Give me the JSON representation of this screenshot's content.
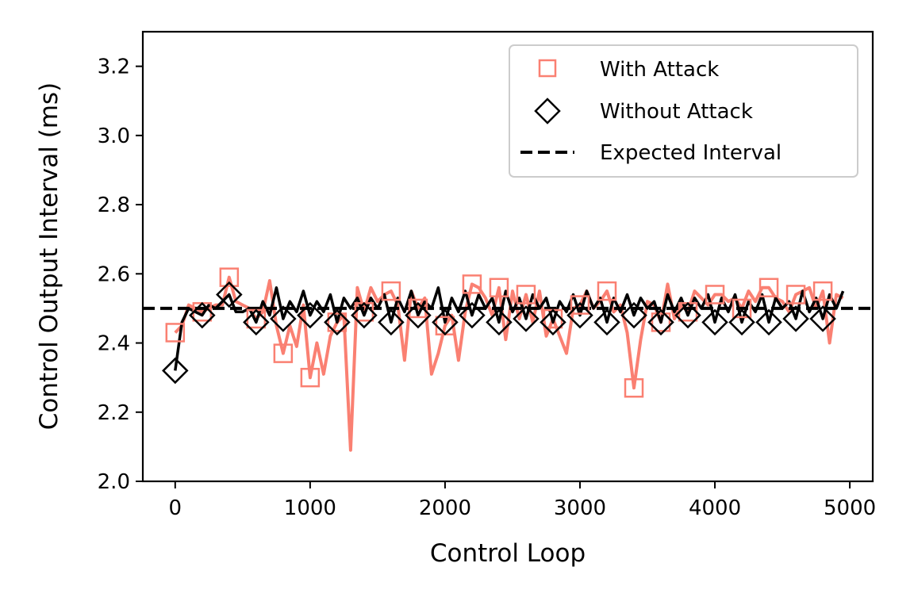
{
  "chart_data": {
    "type": "line",
    "title": "",
    "xlabel": "Control Loop",
    "ylabel": "Control Output Interval (ms)",
    "xlim": [
      -240,
      5170
    ],
    "ylim": [
      2.0,
      3.3
    ],
    "xticks": [
      0,
      1000,
      2000,
      3000,
      4000,
      5000
    ],
    "xtick_labels": [
      "0",
      "1000",
      "2000",
      "3000",
      "4000",
      "5000"
    ],
    "yticks": [
      2.0,
      2.2,
      2.4,
      2.6,
      2.8,
      3.0,
      3.2
    ],
    "ytick_labels": [
      "2.0",
      "2.2",
      "2.4",
      "2.6",
      "2.8",
      "3.0",
      "3.2"
    ],
    "grid": false,
    "legend_position": "top-right",
    "expected_interval": 2.5,
    "x": [
      0,
      50,
      100,
      150,
      200,
      250,
      300,
      350,
      400,
      450,
      500,
      550,
      600,
      650,
      700,
      750,
      800,
      850,
      900,
      950,
      1000,
      1050,
      1100,
      1150,
      1200,
      1250,
      1300,
      1350,
      1400,
      1450,
      1500,
      1550,
      1600,
      1650,
      1700,
      1750,
      1800,
      1850,
      1900,
      1950,
      2000,
      2050,
      2100,
      2150,
      2200,
      2250,
      2300,
      2350,
      2400,
      2450,
      2500,
      2550,
      2600,
      2650,
      2700,
      2750,
      2800,
      2850,
      2900,
      2950,
      3000,
      3050,
      3100,
      3150,
      3200,
      3250,
      3300,
      3350,
      3400,
      3450,
      3500,
      3550,
      3600,
      3650,
      3700,
      3750,
      3800,
      3850,
      3900,
      3950,
      4000,
      4050,
      4100,
      4150,
      4200,
      4250,
      4300,
      4350,
      4400,
      4450,
      4500,
      4550,
      4600,
      4650,
      4700,
      4750,
      4800,
      4850,
      4900,
      4950
    ],
    "marker_every": 4,
    "series": [
      {
        "name": "With Attack",
        "color": "#fa8072",
        "marker": "square",
        "values": [
          2.43,
          2.45,
          2.51,
          2.5,
          2.49,
          2.5,
          2.51,
          2.51,
          2.59,
          2.52,
          2.51,
          2.5,
          2.47,
          2.49,
          2.58,
          2.45,
          2.37,
          2.45,
          2.39,
          2.51,
          2.3,
          2.4,
          2.31,
          2.42,
          2.46,
          2.48,
          2.09,
          2.56,
          2.49,
          2.56,
          2.52,
          2.54,
          2.55,
          2.51,
          2.35,
          2.55,
          2.5,
          2.53,
          2.31,
          2.37,
          2.45,
          2.48,
          2.35,
          2.49,
          2.57,
          2.56,
          2.53,
          2.48,
          2.56,
          2.41,
          2.55,
          2.47,
          2.54,
          2.46,
          2.55,
          2.42,
          2.47,
          2.42,
          2.37,
          2.5,
          2.51,
          2.55,
          2.5,
          2.52,
          2.55,
          2.49,
          2.51,
          2.43,
          2.27,
          2.41,
          2.52,
          2.51,
          2.46,
          2.57,
          2.47,
          2.51,
          2.49,
          2.55,
          2.53,
          2.51,
          2.54,
          2.54,
          2.52,
          2.53,
          2.5,
          2.55,
          2.52,
          2.56,
          2.56,
          2.53,
          2.52,
          2.49,
          2.54,
          2.55,
          2.56,
          2.5,
          2.55,
          2.4,
          2.54,
          2.53
        ]
      },
      {
        "name": "Without Attack",
        "color": "#000000",
        "marker": "diamond",
        "values": [
          2.32,
          2.46,
          2.5,
          2.49,
          2.48,
          2.51,
          2.5,
          2.52,
          2.54,
          2.49,
          2.49,
          2.5,
          2.46,
          2.52,
          2.48,
          2.56,
          2.47,
          2.52,
          2.49,
          2.55,
          2.48,
          2.52,
          2.49,
          2.54,
          2.46,
          2.53,
          2.5,
          2.53,
          2.48,
          2.53,
          2.5,
          2.54,
          2.46,
          2.53,
          2.49,
          2.55,
          2.48,
          2.52,
          2.5,
          2.56,
          2.46,
          2.53,
          2.49,
          2.55,
          2.48,
          2.54,
          2.5,
          2.53,
          2.46,
          2.55,
          2.49,
          2.53,
          2.47,
          2.54,
          2.5,
          2.53,
          2.46,
          2.52,
          2.49,
          2.54,
          2.48,
          2.55,
          2.5,
          2.53,
          2.46,
          2.53,
          2.49,
          2.54,
          2.48,
          2.53,
          2.5,
          2.52,
          2.46,
          2.54,
          2.49,
          2.53,
          2.48,
          2.53,
          2.5,
          2.54,
          2.46,
          2.53,
          2.49,
          2.54,
          2.46,
          2.52,
          2.49,
          2.54,
          2.46,
          2.53,
          2.5,
          2.52,
          2.47,
          2.55,
          2.49,
          2.53,
          2.47,
          2.54,
          2.5,
          2.55
        ]
      }
    ],
    "legend": [
      {
        "label": "With Attack",
        "symbol": "square",
        "color": "#fa8072"
      },
      {
        "label": "Without Attack",
        "symbol": "diamond",
        "color": "#000000"
      },
      {
        "label": "Expected Interval",
        "symbol": "dashed-line",
        "color": "#000000"
      }
    ]
  }
}
